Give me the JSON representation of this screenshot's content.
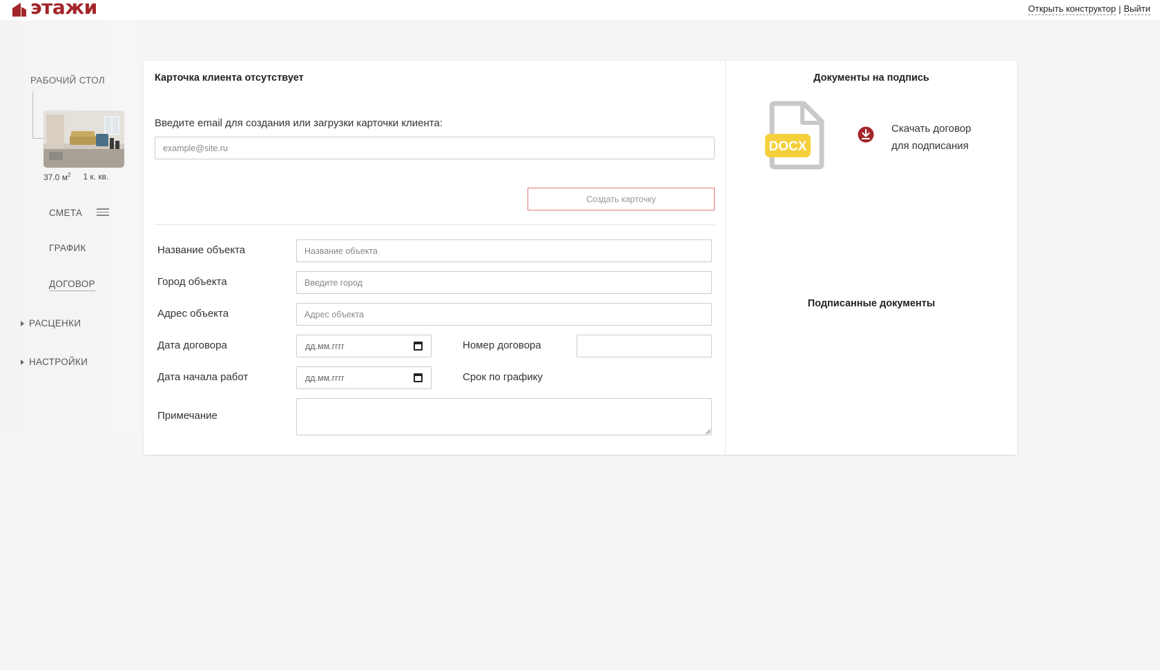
{
  "app": {
    "logo_text": "этажи",
    "brand_color": "#a3262a"
  },
  "header": {
    "open_constructor": "Открыть конструктор",
    "separator": "|",
    "logout": "Выйти"
  },
  "sidebar": {
    "home": "РАБОЧИЙ СТОЛ",
    "apartment": {
      "area": "37.0 м",
      "area_sup": "2",
      "rooms": "1 к. кв."
    },
    "items": [
      {
        "label": "СМЕТА",
        "icon": "menu-icon"
      },
      {
        "label": "ГРАФИК"
      },
      {
        "label": "ДОГОВОР",
        "active": true
      }
    ],
    "groups": [
      {
        "label": "РАСЦЕНКИ",
        "icon": "caret-right-icon"
      },
      {
        "label": "НАСТРОЙКИ",
        "icon": "caret-right-icon"
      }
    ]
  },
  "client": {
    "title": "Карточка клиента отсутствует",
    "email_label": "Введите email для создания или загрузки карточки клиента:",
    "email_placeholder": "example@site.ru",
    "create_button": "Создать карточку"
  },
  "form": {
    "object_name_label": "Название объекта",
    "object_name_placeholder": "Название объекта",
    "city_label": "Город объекта",
    "city_placeholder": "Введите город",
    "address_label": "Адрес объекта",
    "address_placeholder": "Адрес объекта",
    "contract_date_label": "Дата договора",
    "contract_date_value": "дд.мм.гггг",
    "contract_number_label": "Номер договора",
    "start_date_label": "Дата начала работ",
    "start_date_value": "дд.мм.гггг",
    "schedule_term_label": "Срок по графику",
    "note_label": "Примечание"
  },
  "documents": {
    "to_sign_title": "Документы на подпись",
    "file_type": "DOCX",
    "download_line1": "Скачать договор",
    "download_line2": "для подписания",
    "signed_title": "Подписанные документы"
  }
}
